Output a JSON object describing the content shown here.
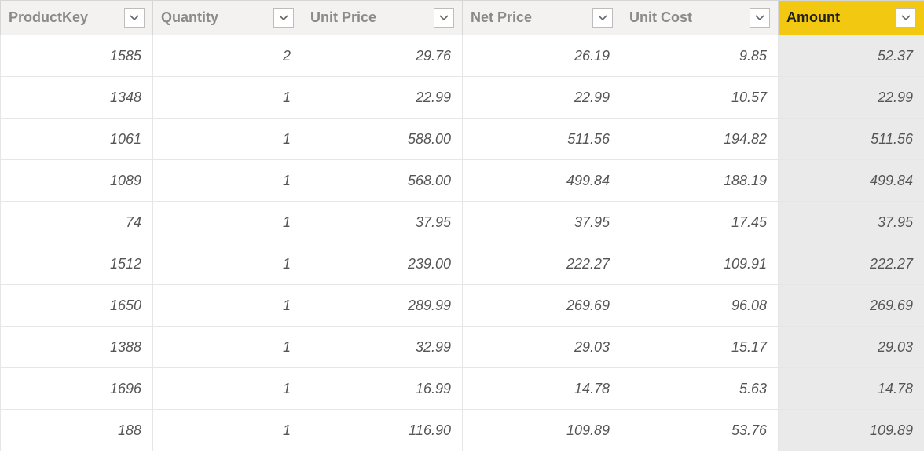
{
  "table": {
    "selected_column_index": 5,
    "columns": [
      {
        "label": "ProductKey"
      },
      {
        "label": "Quantity"
      },
      {
        "label": "Unit Price"
      },
      {
        "label": "Net Price"
      },
      {
        "label": "Unit Cost"
      },
      {
        "label": "Amount"
      }
    ],
    "rows": [
      {
        "c0": "1585",
        "c1": "2",
        "c2": "29.76",
        "c3": "26.19",
        "c4": "9.85",
        "c5": "52.37"
      },
      {
        "c0": "1348",
        "c1": "1",
        "c2": "22.99",
        "c3": "22.99",
        "c4": "10.57",
        "c5": "22.99"
      },
      {
        "c0": "1061",
        "c1": "1",
        "c2": "588.00",
        "c3": "511.56",
        "c4": "194.82",
        "c5": "511.56"
      },
      {
        "c0": "1089",
        "c1": "1",
        "c2": "568.00",
        "c3": "499.84",
        "c4": "188.19",
        "c5": "499.84"
      },
      {
        "c0": "74",
        "c1": "1",
        "c2": "37.95",
        "c3": "37.95",
        "c4": "17.45",
        "c5": "37.95"
      },
      {
        "c0": "1512",
        "c1": "1",
        "c2": "239.00",
        "c3": "222.27",
        "c4": "109.91",
        "c5": "222.27"
      },
      {
        "c0": "1650",
        "c1": "1",
        "c2": "289.99",
        "c3": "269.69",
        "c4": "96.08",
        "c5": "269.69"
      },
      {
        "c0": "1388",
        "c1": "1",
        "c2": "32.99",
        "c3": "29.03",
        "c4": "15.17",
        "c5": "29.03"
      },
      {
        "c0": "1696",
        "c1": "1",
        "c2": "16.99",
        "c3": "14.78",
        "c4": "5.63",
        "c5": "14.78"
      },
      {
        "c0": "188",
        "c1": "1",
        "c2": "116.90",
        "c3": "109.89",
        "c4": "53.76",
        "c5": "109.89"
      }
    ]
  }
}
